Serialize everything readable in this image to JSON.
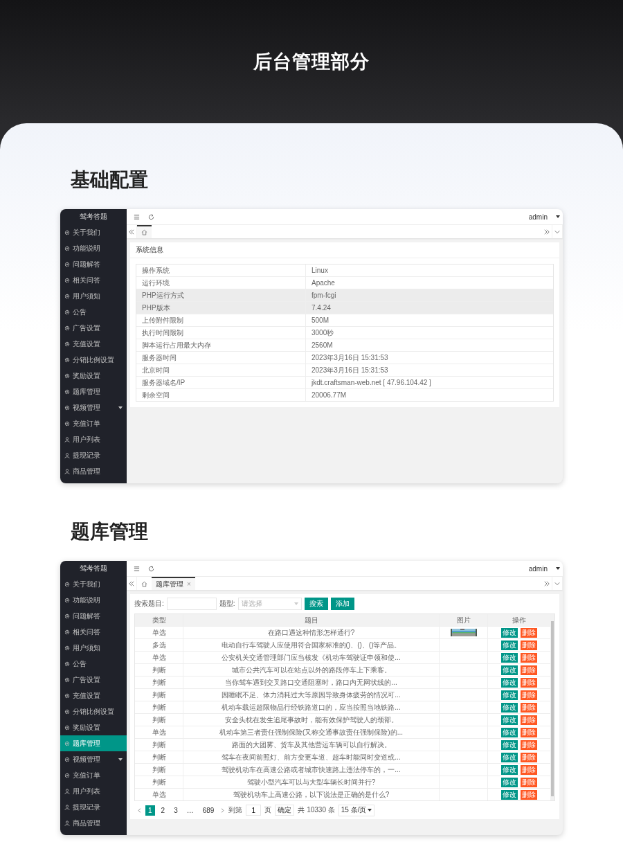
{
  "header": {
    "title": "后台管理部分"
  },
  "sections": [
    {
      "heading": "基础配置",
      "window": {
        "kind": "info",
        "brand": "驾考答题",
        "user": "admin",
        "sidebar": [
          {
            "label": "关于我们",
            "kind": "gear",
            "selected": false,
            "expandable": false
          },
          {
            "label": "功能说明",
            "kind": "gear",
            "selected": false,
            "expandable": false
          },
          {
            "label": "问题解答",
            "kind": "gear",
            "selected": false,
            "expandable": false
          },
          {
            "label": "相关问答",
            "kind": "gear",
            "selected": false,
            "expandable": false
          },
          {
            "label": "用户须知",
            "kind": "gear",
            "selected": false,
            "expandable": false
          },
          {
            "label": "公告",
            "kind": "gear",
            "selected": false,
            "expandable": false
          },
          {
            "label": "广告设置",
            "kind": "gear",
            "selected": false,
            "expandable": false
          },
          {
            "label": "充值设置",
            "kind": "gear",
            "selected": false,
            "expandable": false
          },
          {
            "label": "分销比例设置",
            "kind": "gear",
            "selected": false,
            "expandable": false
          },
          {
            "label": "奖励设置",
            "kind": "gear",
            "selected": false,
            "expandable": false
          },
          {
            "label": "题库管理",
            "kind": "gear",
            "selected": false,
            "expandable": false
          },
          {
            "label": "视频管理",
            "kind": "gear",
            "selected": false,
            "expandable": true
          },
          {
            "label": "充值订单",
            "kind": "gear",
            "selected": false,
            "expandable": false
          },
          {
            "label": "用户列表",
            "kind": "user",
            "selected": false,
            "expandable": false
          },
          {
            "label": "提现记录",
            "kind": "user",
            "selected": false,
            "expandable": false
          },
          {
            "label": "商品管理",
            "kind": "user",
            "selected": false,
            "expandable": false
          }
        ],
        "tabs": [
          {
            "kind": "home",
            "selected": true
          }
        ],
        "panel_title": "系统信息",
        "info_rows": [
          {
            "label": "操作系统",
            "value": "Linux",
            "highlighted": false
          },
          {
            "label": "运行环境",
            "value": "Apache",
            "highlighted": false
          },
          {
            "label": "PHP运行方式",
            "value": "fpm-fcgi",
            "highlighted": true
          },
          {
            "label": "PHP版本",
            "value": "7.4.24",
            "highlighted": true
          },
          {
            "label": "上传附件限制",
            "value": "500M",
            "highlighted": false
          },
          {
            "label": "执行时间限制",
            "value": "3000秒",
            "highlighted": false
          },
          {
            "label": "脚本运行占用最大内存",
            "value": "2560M",
            "highlighted": false
          },
          {
            "label": "服务器时间",
            "value": "2023年3月16日 15:31:53",
            "highlighted": false
          },
          {
            "label": "北京时间",
            "value": "2023年3月16日 15:31:53",
            "highlighted": false
          },
          {
            "label": "服务器域名/IP",
            "value": "jkdt.craftsman-web.net [ 47.96.104.42 ]",
            "highlighted": false
          },
          {
            "label": "剩余空间",
            "value": "20006.77M",
            "highlighted": false
          }
        ]
      }
    },
    {
      "heading": "题库管理",
      "window": {
        "kind": "questions",
        "brand": "驾考答题",
        "user": "admin",
        "sidebar": [
          {
            "label": "关于我们",
            "kind": "gear",
            "selected": false,
            "expandable": false
          },
          {
            "label": "功能说明",
            "kind": "gear",
            "selected": false,
            "expandable": false
          },
          {
            "label": "问题解答",
            "kind": "gear",
            "selected": false,
            "expandable": false
          },
          {
            "label": "相关问答",
            "kind": "gear",
            "selected": false,
            "expandable": false
          },
          {
            "label": "用户须知",
            "kind": "gear",
            "selected": false,
            "expandable": false
          },
          {
            "label": "公告",
            "kind": "gear",
            "selected": false,
            "expandable": false
          },
          {
            "label": "广告设置",
            "kind": "gear",
            "selected": false,
            "expandable": false
          },
          {
            "label": "充值设置",
            "kind": "gear",
            "selected": false,
            "expandable": false
          },
          {
            "label": "分销比例设置",
            "kind": "gear",
            "selected": false,
            "expandable": false
          },
          {
            "label": "奖励设置",
            "kind": "gear",
            "selected": false,
            "expandable": false
          },
          {
            "label": "题库管理",
            "kind": "gear",
            "selected": true,
            "expandable": false
          },
          {
            "label": "视频管理",
            "kind": "gear",
            "selected": false,
            "expandable": true
          },
          {
            "label": "充值订单",
            "kind": "gear",
            "selected": false,
            "expandable": false
          },
          {
            "label": "用户列表",
            "kind": "user",
            "selected": false,
            "expandable": false
          },
          {
            "label": "提现记录",
            "kind": "user",
            "selected": false,
            "expandable": false
          },
          {
            "label": "商品管理",
            "kind": "user",
            "selected": false,
            "expandable": false
          }
        ],
        "tabs": [
          {
            "kind": "home",
            "selected": false
          },
          {
            "kind": "page",
            "label": "题库管理",
            "close": "×",
            "selected": true
          }
        ],
        "search": {
          "label": "搜索题目:",
          "type_label": "题型:",
          "type_placeholder": "请选择",
          "search_button": "搜索",
          "add_button": "添加"
        },
        "columns": [
          "类型",
          "题目",
          "图片",
          "操作"
        ],
        "rows": [
          {
            "type": "单选",
            "question": "在路口遇这种情形怎样通行?",
            "edit": "修改",
            "delete": "删除"
          },
          {
            "type": "多选",
            "question": "电动自行车驾驶人应使用符合国家标准的()、()、()等产品。",
            "edit": "修改",
            "delete": "删除"
          },
          {
            "type": "单选",
            "question": "公安机关交通管理部门应当核发《机动车驾驶证申领和使...",
            "edit": "修改",
            "delete": "删除"
          },
          {
            "type": "判断",
            "question": "城市公共汽车可以在站点以外的路段停车上下乘客。",
            "edit": "修改",
            "delete": "删除"
          },
          {
            "type": "判断",
            "question": "当你驾车遇到交叉路口交通阻塞时，路口内无网状线的...",
            "edit": "修改",
            "delete": "删除"
          },
          {
            "type": "判断",
            "question": "因睡眠不足、体力消耗过大等原因导致身体疲劳的情况可...",
            "edit": "修改",
            "delete": "删除"
          },
          {
            "type": "判断",
            "question": "机动车载运超限物品行经铁路道口的，应当按照当地铁路...",
            "edit": "修改",
            "delete": "删除"
          },
          {
            "type": "判断",
            "question": "安全头枕在发生追尾事故时，能有效保护驾驶人的颈部。",
            "edit": "修改",
            "delete": "删除"
          },
          {
            "type": "单选",
            "question": "机动车第三者责任强制保险(又称交通事故责任强制保险)的...",
            "edit": "修改",
            "delete": "删除"
          },
          {
            "type": "判断",
            "question": "路面的大团雾、货车及其他营运车辆可以自行解决。",
            "edit": "修改",
            "delete": "删除"
          },
          {
            "type": "判断",
            "question": "驾车在夜间前照灯、前方变更车道、超车时能同时变道或...",
            "edit": "修改",
            "delete": "删除"
          },
          {
            "type": "判断",
            "question": "驾驶机动车在高速公路或者城市快速路上违法停车的，一...",
            "edit": "修改",
            "delete": "删除"
          },
          {
            "type": "判断",
            "question": "驾驶小型汽车可以与大型车辆长时间并行?",
            "edit": "修改",
            "delete": "删除"
          },
          {
            "type": "单选",
            "question": "驾驶机动车上高速公路，以下说法是正确的是什么?",
            "edit": "修改",
            "delete": "删除"
          }
        ],
        "pagination": {
          "pages": [
            {
              "kind": "page",
              "label": "1",
              "selected": true
            },
            {
              "kind": "page",
              "label": "2",
              "selected": false
            },
            {
              "kind": "page",
              "label": "3",
              "selected": false
            },
            {
              "kind": "gap",
              "label": "…"
            },
            {
              "kind": "page",
              "label": "689",
              "selected": false
            }
          ],
          "goto_before": "到第",
          "goto_value": "1",
          "goto_after": "页",
          "confirm": "确定",
          "total": "共 10330 条",
          "page_size": "15 条/页"
        }
      }
    }
  ]
}
